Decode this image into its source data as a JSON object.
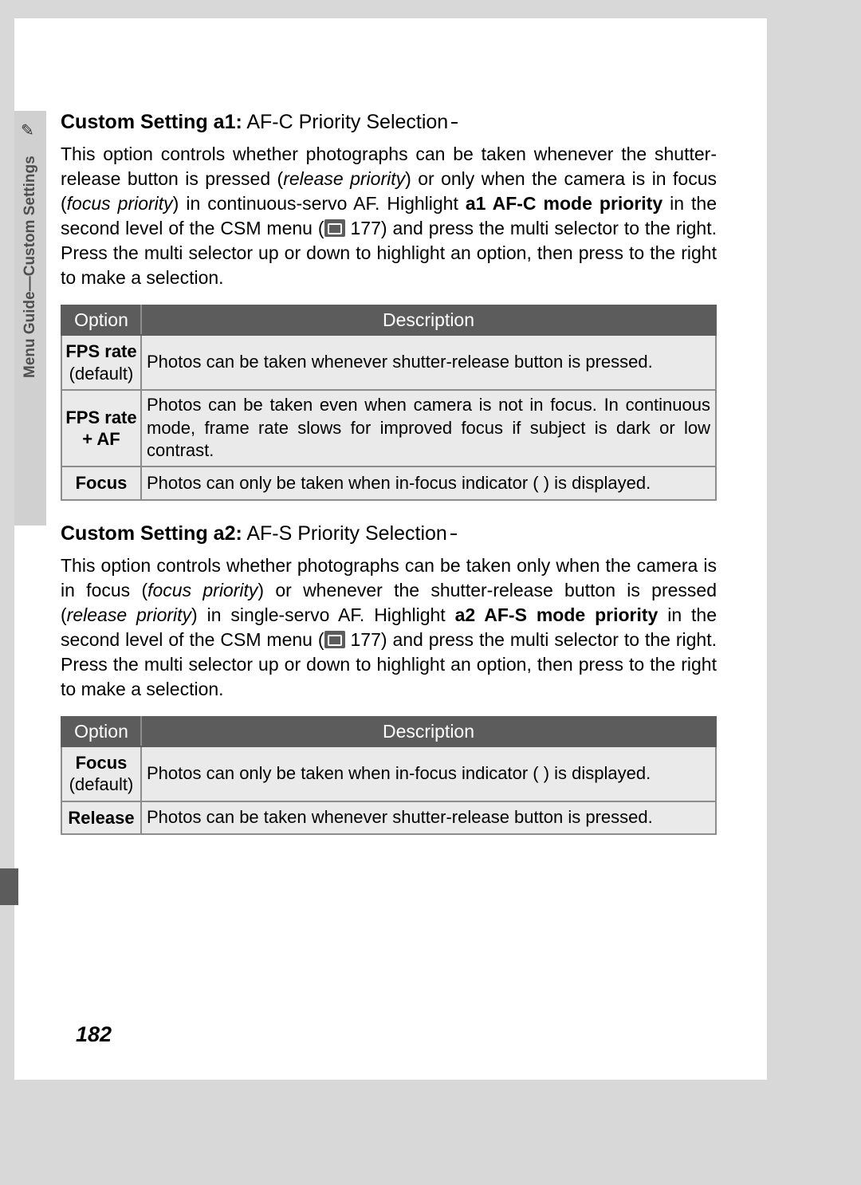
{
  "sidebar_label": "Menu Guide—Custom Settings",
  "page_number": "182",
  "section_a1": {
    "title_bold": "Custom Setting a1:",
    "title_rest": " AF-C Priority Selection",
    "para_segments": [
      {
        "t": "This option controls whether photographs can be taken whenever the shutter-release button is pressed ("
      },
      {
        "t": "release priority",
        "i": true
      },
      {
        "t": ") or only when the camera is in focus ("
      },
      {
        "t": "focus priority",
        "i": true
      },
      {
        "t": ") in continuous-servo AF. Highlight "
      },
      {
        "t": "a1 AF-C mode priority",
        "b": true
      },
      {
        "t": " in the second level of the CSM menu ("
      },
      {
        "icon": true
      },
      {
        "t": " 177) and press the multi selector to the right.  Press the multi selector up or down to highlight an option, then press to the right to make a selection."
      }
    ],
    "table": {
      "head_option": "Option",
      "head_desc": "Description",
      "rows": [
        {
          "opt_html": "<span class=\"b\">FPS rate</span><br>(default)",
          "desc": "Photos can be taken whenever shutter-release button is pressed."
        },
        {
          "opt_html": "<span class=\"b\">FPS rate + AF</span>",
          "desc": "Photos can be taken even when camera is not in focus.  In continuous mode, frame rate slows for improved focus if subject is dark or low contrast."
        },
        {
          "opt_html": "<span class=\"b\">Focus</span>",
          "desc": "Photos can only be taken when in-focus indicator (   ) is displayed."
        }
      ]
    }
  },
  "section_a2": {
    "title_bold": "Custom Setting a2:",
    "title_rest": " AF-S Priority Selection",
    "para_segments": [
      {
        "t": "This option controls whether photographs can be taken only when the camera is in focus ("
      },
      {
        "t": "focus priority",
        "i": true
      },
      {
        "t": ") or whenever the shutter-release button is pressed ("
      },
      {
        "t": "release priority",
        "i": true
      },
      {
        "t": ") in single-servo AF.  Highlight "
      },
      {
        "t": "a2 AF-S mode priority",
        "b": true
      },
      {
        "t": " in the second level of the CSM menu ("
      },
      {
        "icon": true
      },
      {
        "t": " 177) and press the multi selector to the right.  Press the multi selector up or down to highlight an option, then press to the right to make a selection."
      }
    ],
    "table": {
      "head_option": "Option",
      "head_desc": "Description",
      "rows": [
        {
          "opt_html": "<span class=\"b\">Focus</span><br>(default)",
          "desc": "Photos can only be taken when in-focus indicator (   ) is displayed."
        },
        {
          "opt_html": "<span class=\"b\">Release</span>",
          "desc": "Photos can be taken whenever shutter-release button is pressed."
        }
      ]
    }
  }
}
